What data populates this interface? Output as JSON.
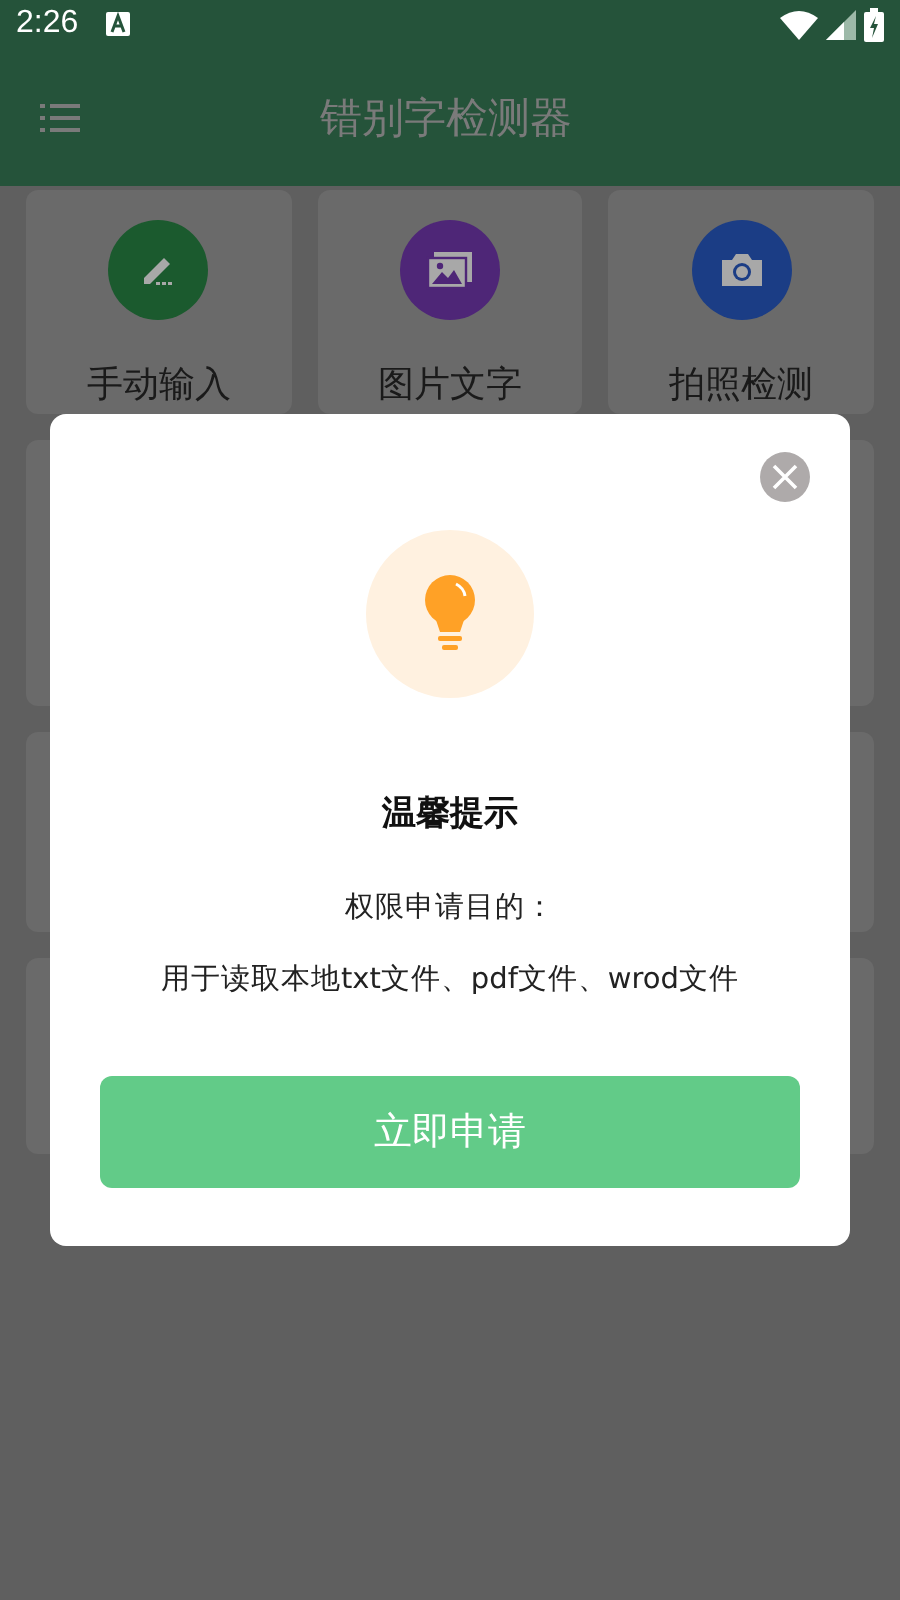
{
  "status_bar": {
    "time": "2:26"
  },
  "app_bar": {
    "title": "错别字检测器"
  },
  "tools": [
    {
      "label": "手动输入",
      "kind": "pencil",
      "color": "#1b5a2e"
    },
    {
      "label": "图片文字",
      "kind": "image",
      "color": "#4e2677"
    },
    {
      "label": "拍照检测",
      "kind": "camera",
      "color": "#1b3d85"
    }
  ],
  "dialog": {
    "title": "温馨提示",
    "lines": [
      "权限申请目的：",
      "用于读取本地txt文件、pdf文件、wrod文件"
    ],
    "button": "立即申请"
  }
}
